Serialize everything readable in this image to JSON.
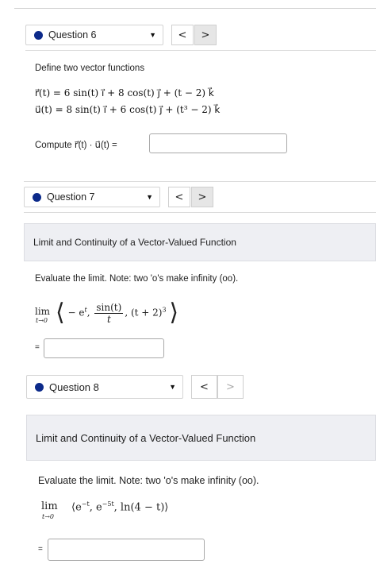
{
  "question6": {
    "selector_label": "Question 6",
    "prev": "<",
    "next": ">",
    "intro": "Define two vector functions",
    "r_eq": "r⃗(t) = 6 sin(t) i⃗ + 8 cos(t) j⃗ + (t − 2) k⃗",
    "u_eq": "u⃗(t) = 8 sin(t) i⃗ + 6 cos(t) j⃗ + (t³ − 2) k⃗",
    "compute": "Compute r⃗(t) · u⃗(t) =",
    "answer_value": ""
  },
  "question7": {
    "selector_label": "Question 7",
    "prev": "<",
    "next": ">",
    "banner": "Limit and Continuity of a Vector-Valued Function",
    "instruction": "Evaluate the limit. Note: two 'o's make infinity (oo).",
    "lim": "lim",
    "lim_sub": "t→0",
    "expr_a": "− e",
    "expr_a_sup": "t",
    "frac_num": "sin(t)",
    "frac_den": "t",
    "expr_c": "(t + 2)",
    "expr_c_sup": "3",
    "equals": "=",
    "answer_value": ""
  },
  "question8": {
    "selector_label": "Question 8",
    "prev": "<",
    "next": ">",
    "banner": "Limit and Continuity of a Vector-Valued Function",
    "instruction": "Evaluate the limit. Note: two 'o's make infinity (oo).",
    "lim": "lim",
    "lim_sub": "t→0",
    "expr": "⟨e",
    "sup1": "−t",
    "expr_mid": ", e",
    "sup2": "−5t",
    "expr_end": ", ln(4 − t)⟩",
    "equals": "=",
    "answer_value": ""
  },
  "colors": {
    "dot": "#0c2a8a",
    "banner_bg": "#eeeff3"
  }
}
